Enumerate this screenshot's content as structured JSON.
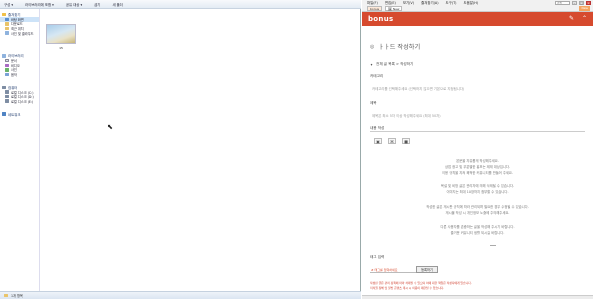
{
  "explorer": {
    "toolbar": {
      "item1": "구성 ▾",
      "item2": "라이브러리에 포함 ▾",
      "item3": "공유 대상 ▾",
      "item4": "굽기",
      "item5": "새 폴더"
    },
    "nav": {
      "favorites_head": "즐겨찾기",
      "favorites": [
        "바탕 화면",
        "다운로드",
        "최근 위치",
        "사진 및 클라우드"
      ],
      "libraries_head": "라이브러리",
      "libraries": [
        "문서",
        "비디오",
        "사진",
        "음악"
      ],
      "computer_head": "컴퓨터",
      "computer": [
        "로컬 디스크 (C:)",
        "로컬 디스크 (D:)",
        "로컬 디스크 (E:)"
      ],
      "network_head": "네트워크"
    },
    "thumbnail_label": "15",
    "status_text": "1개 항목"
  },
  "panel": {
    "menu": [
      "파일(F)",
      "편집(E)",
      "보기(V)",
      "즐겨찾기(A)",
      "도구(T)",
      "도움말(H)"
    ],
    "tabs": [
      "bonus",
      "🖼 New"
    ],
    "search_placeholder": "검색",
    "bookmark": "New",
    "logo": "bonus",
    "title": "ㅏㅏ드 작성하기",
    "sub_label": "전체 글 목록 > 작성하기",
    "field1_label": "카테고리",
    "field1_text": "카테고리를 선택해주세요 (선택하지 않으면 기본으로 지정됩니다)",
    "field2_label": "제목",
    "field2_text": "제목은 최소 5자 이상 작성해주세요 (최대 50자)",
    "editor_label": "내용 작성",
    "editor_lines": [
      "본문을 자유롭게 작성해주세요.",
      "상업 광고 및 무분별한 홍보는 제재 대상입니다.",
      "이용 규칙을 지켜 쾌적한 커뮤니티를 만들어 주세요.",
      "",
      "욕설 및 비방 글은 관리자에 의해 삭제될 수 있습니다.",
      "이미지는 최대 10장까지 첨부할 수 있습니다.",
      "",
      "작성한 글은 게시판 규칙에 따라 관리되며 필요한 경우 수정될 수 있습니다.",
      "게시물 작성 시 개인정보 노출에 주의해주세요.",
      "",
      "다른 사용자를 존중하는 글을 작성해 주시기 바랍니다.",
      "즐거운 커뮤니티 생활 되시길 바랍니다."
    ],
    "after_label": "태그 입력",
    "after_input": "# 태그를 입력하세요",
    "after_button": "등록하기",
    "footnotes": [
      "작성된 글은 관리 정책에 따라 삭제될 수 있으며 이에 대한 책임은 작성자에게 있습니다.",
      "저작권 침해 및 불법 콘텐츠 게시 시 이용이 제한될 수 있습니다."
    ]
  }
}
